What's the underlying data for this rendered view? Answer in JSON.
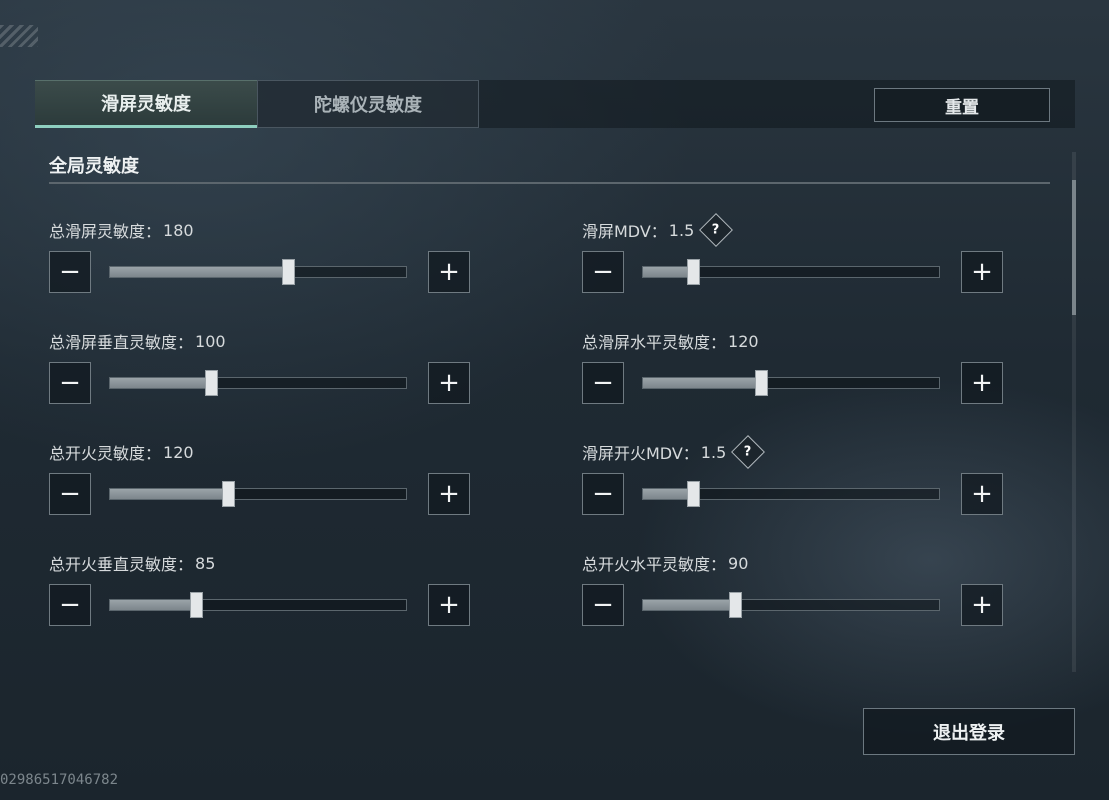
{
  "tabs": [
    {
      "label": "滑屏灵敏度",
      "active": true
    },
    {
      "label": "陀螺仪灵敏度",
      "active": false
    }
  ],
  "reset_label": "重置",
  "section_title": "全局灵敏度",
  "settings_left": [
    {
      "label": "总滑屏灵敏度：",
      "value": "180",
      "fraction": 0.6,
      "help": false
    },
    {
      "label": "总滑屏垂直灵敏度：",
      "value": "100",
      "fraction": 0.34,
      "help": false
    },
    {
      "label": "总开火灵敏度：",
      "value": "120",
      "fraction": 0.4,
      "help": false
    },
    {
      "label": "总开火垂直灵敏度：",
      "value": "85",
      "fraction": 0.29,
      "help": false
    }
  ],
  "settings_right": [
    {
      "label": "滑屏MDV：",
      "value": "1.5",
      "fraction": 0.17,
      "help": true
    },
    {
      "label": "总滑屏水平灵敏度：",
      "value": "120",
      "fraction": 0.4,
      "help": false
    },
    {
      "label": "滑屏开火MDV：",
      "value": "1.5",
      "fraction": 0.17,
      "help": true
    },
    {
      "label": "总开火水平灵敏度：",
      "value": "90",
      "fraction": 0.31,
      "help": false
    }
  ],
  "help_glyph": "?",
  "minus_glyph": "−",
  "plus_glyph": "+",
  "logout_label": "退出登录",
  "uid_text": "02986517046782"
}
